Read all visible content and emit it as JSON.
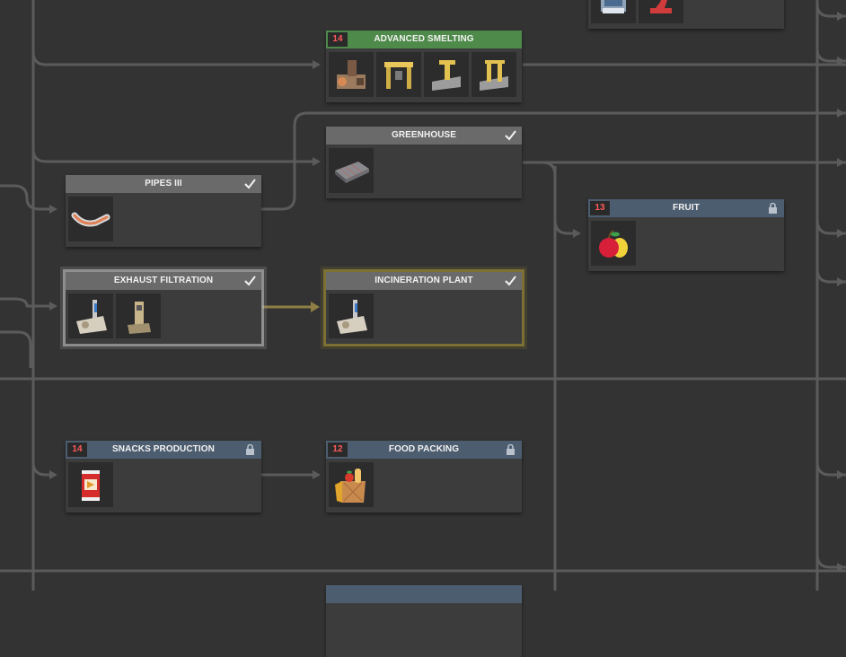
{
  "nodes": {
    "advanced_smelting": {
      "title": "ADVANCED SMELTING",
      "tier": "14",
      "state": "in-progress",
      "icons": [
        "smelter-machine-icon",
        "gantry-crane-icon",
        "sorting-arm-icon",
        "drilling-rig-icon"
      ]
    },
    "greenhouse": {
      "title": "GREENHOUSE",
      "state": "completed",
      "icons": [
        "greenhouse-tray-icon"
      ]
    },
    "pipes_iii": {
      "title": "PIPES III",
      "state": "completed",
      "icons": [
        "pipe-segment-icon"
      ]
    },
    "fruit": {
      "title": "FRUIT",
      "tier": "13",
      "state": "locked",
      "icons": [
        "fruit-icon"
      ]
    },
    "exhaust_filtration": {
      "title": "EXHAUST FILTRATION",
      "state": "completed",
      "icons": [
        "exhaust-filter-icon",
        "filtration-tower-icon"
      ]
    },
    "incineration_plant": {
      "title": "INCINERATION PLANT",
      "state": "completed",
      "icons": [
        "incinerator-icon"
      ]
    },
    "snacks_production": {
      "title": "SNACKS PRODUCTION",
      "tier": "14",
      "state": "locked",
      "icons": [
        "snack-bag-icon"
      ]
    },
    "food_packing": {
      "title": "FOOD PACKING",
      "tier": "12",
      "state": "locked",
      "icons": [
        "food-crate-icon"
      ]
    },
    "top_partial": {
      "state": "unknown",
      "icons": [
        "processor-machine-icon",
        "red-robot-arm-icon"
      ]
    },
    "bottom_partial": {
      "state": "locked",
      "icons": []
    }
  },
  "colors": {
    "background": "#333334",
    "connector": "#5b5b5c",
    "active_connector": "#8f7f45",
    "tier_number": "#ff5a5a",
    "completed_header": "#6a6a6b",
    "locked_header": "#4d5d70",
    "in_progress_header": "#4e8a4a"
  }
}
